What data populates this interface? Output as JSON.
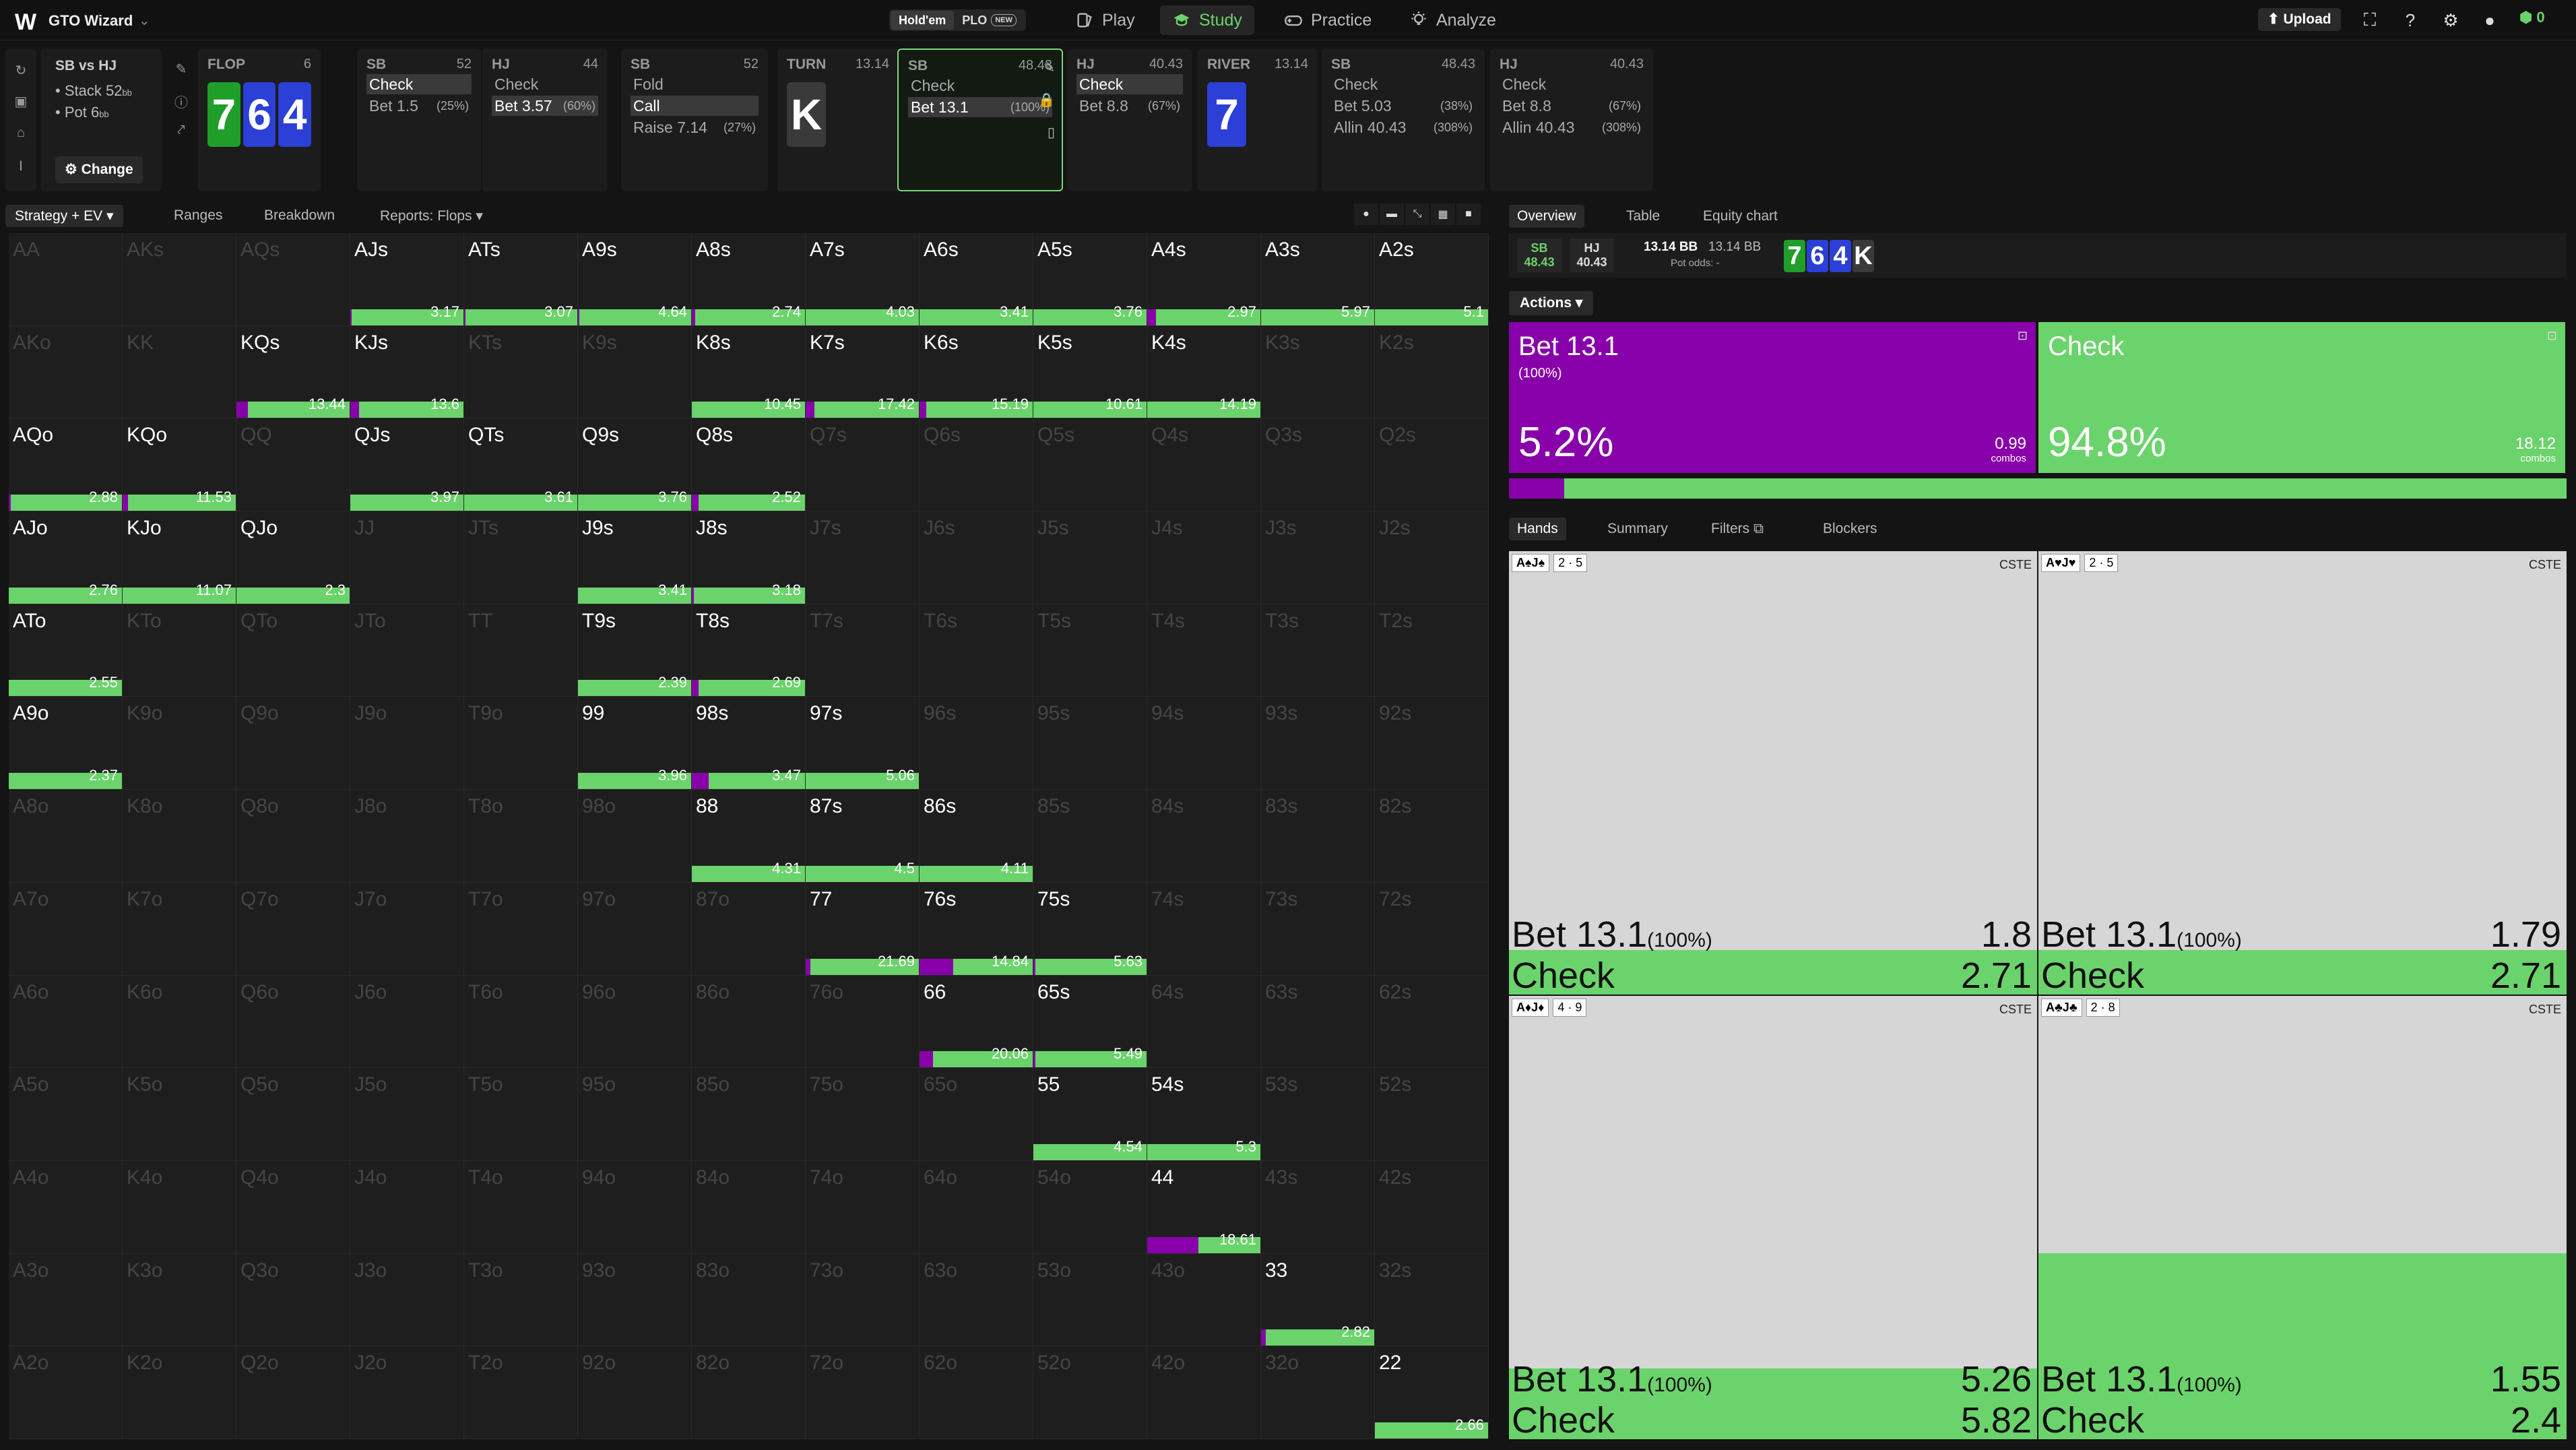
{
  "app": {
    "name": "GTO Wizard",
    "logo": "W"
  },
  "game_toggle": {
    "holdem": "Hold'em",
    "plo": "PLO",
    "new_badge": "NEW"
  },
  "nav": {
    "play": "Play",
    "study": "Study",
    "practice": "Practice",
    "analyze": "Analyze"
  },
  "top_right": {
    "upload": "Upload",
    "wallet": "0"
  },
  "spot": {
    "title": "SB vs HJ",
    "stack": "Stack 52",
    "stack_unit": "bb",
    "pot": "Pot 6",
    "pot_unit": "bb",
    "change": "Change"
  },
  "tree": [
    {
      "title": "FLOP",
      "value": "6",
      "board": [
        "7",
        "6",
        "4"
      ],
      "colors": [
        "g",
        "b",
        "b"
      ]
    },
    {
      "title": "SB",
      "value": "52",
      "actions": [
        {
          "a": "Check",
          "p": "",
          "sel": true
        },
        {
          "a": "Bet 1.5",
          "p": "(25%)",
          "sel": false
        }
      ]
    },
    {
      "title": "HJ",
      "value": "44",
      "actions": [
        {
          "a": "Check",
          "p": "",
          "sel": false
        },
        {
          "a": "Bet 3.57",
          "p": "(60%)",
          "sel": true
        }
      ]
    },
    {
      "title": "SB",
      "value": "52",
      "actions": [
        {
          "a": "Fold",
          "p": "",
          "sel": false
        },
        {
          "a": "Call",
          "p": "",
          "sel": true
        },
        {
          "a": "Raise 7.14",
          "p": "(27%)",
          "sel": false
        }
      ]
    },
    {
      "title": "TURN",
      "value": "13.14",
      "board": [
        "K"
      ],
      "colors": [
        "k"
      ]
    },
    {
      "title": "SB",
      "value": "48.43",
      "actions": [
        {
          "a": "Check",
          "p": "",
          "sel": false
        },
        {
          "a": "Bet 13.1",
          "p": "(100%)",
          "sel": true
        }
      ],
      "current": true
    },
    {
      "title": "HJ",
      "value": "40.43",
      "actions": [
        {
          "a": "Check",
          "p": "",
          "sel": true
        },
        {
          "a": "Bet 8.8",
          "p": "(67%)",
          "sel": false
        }
      ]
    },
    {
      "title": "RIVER",
      "value": "13.14",
      "board": [
        "7"
      ],
      "colors": [
        "b"
      ]
    },
    {
      "title": "SB",
      "value": "48.43",
      "actions": [
        {
          "a": "Check",
          "p": "",
          "sel": false
        },
        {
          "a": "Bet 5.03",
          "p": "(38%)",
          "sel": false
        },
        {
          "a": "Allin 40.43",
          "p": "(308%)",
          "sel": false
        }
      ]
    },
    {
      "title": "HJ",
      "value": "40.43",
      "actions": [
        {
          "a": "Check",
          "p": "",
          "sel": false
        },
        {
          "a": "Bet 8.8",
          "p": "(67%)",
          "sel": false
        },
        {
          "a": "Allin 40.43",
          "p": "(308%)",
          "sel": false
        }
      ]
    }
  ],
  "left_tabs": {
    "strategy": "Strategy + EV",
    "ranges": "Ranges",
    "breakdown": "Breakdown",
    "reports": "Reports: Flops"
  },
  "ranks": [
    "A",
    "K",
    "Q",
    "J",
    "T",
    "9",
    "8",
    "7",
    "6",
    "5",
    "4",
    "3",
    "2"
  ],
  "hands": {
    "AJs": {
      "ev": "3.17",
      "bet": 0.01
    },
    "ATs": {
      "ev": "3.07",
      "bet": 0.01
    },
    "A9s": {
      "ev": "4.64",
      "bet": 0.01
    },
    "A8s": {
      "ev": "2.74",
      "bet": 0.03
    },
    "A7s": {
      "ev": "4.03",
      "bet": 0
    },
    "A6s": {
      "ev": "3.41",
      "bet": 0
    },
    "A5s": {
      "ev": "3.76",
      "bet": 0
    },
    "A4s": {
      "ev": "2.97",
      "bet": 0.08
    },
    "A3s": {
      "ev": "5.97",
      "bet": 0
    },
    "A2s": {
      "ev": "5.1",
      "bet": 0
    },
    "KQs": {
      "ev": "13.44",
      "bet": 0.1
    },
    "KJs": {
      "ev": "13.6",
      "bet": 0.08
    },
    "K8s": {
      "ev": "10.45",
      "bet": 0
    },
    "K7s": {
      "ev": "17.42",
      "bet": 0.08
    },
    "K6s": {
      "ev": "15.19",
      "bet": 0.06
    },
    "K5s": {
      "ev": "10.61",
      "bet": 0
    },
    "K4s": {
      "ev": "14.19",
      "bet": 0
    },
    "AQo": {
      "ev": "2.88",
      "bet": 0.02
    },
    "KQo": {
      "ev": "11.53",
      "bet": 0.05
    },
    "QJs": {
      "ev": "3.97",
      "bet": 0
    },
    "QTs": {
      "ev": "3.61",
      "bet": 0
    },
    "Q9s": {
      "ev": "3.76",
      "bet": 0
    },
    "Q8s": {
      "ev": "2.52",
      "bet": 0.06
    },
    "AJo": {
      "ev": "2.76",
      "bet": 0
    },
    "KJo": {
      "ev": "11.07",
      "bet": 0
    },
    "QJo": {
      "ev": "2.3",
      "bet": 0
    },
    "J9s": {
      "ev": "3.41",
      "bet": 0
    },
    "J8s": {
      "ev": "3.18",
      "bet": 0.02
    },
    "ATo": {
      "ev": "2.55",
      "bet": 0
    },
    "T9s": {
      "ev": "2.39",
      "bet": 0
    },
    "T8s": {
      "ev": "2.69",
      "bet": 0.06
    },
    "A9o": {
      "ev": "2.37",
      "bet": 0
    },
    "99": {
      "ev": "3.96",
      "bet": 0
    },
    "98s": {
      "ev": "3.47",
      "bet": 0.15
    },
    "97s": {
      "ev": "5.06",
      "bet": 0
    },
    "88": {
      "ev": "4.31",
      "bet": 0
    },
    "87s": {
      "ev": "4.5",
      "bet": 0
    },
    "86s": {
      "ev": "4.11",
      "bet": 0
    },
    "77": {
      "ev": "21.69",
      "bet": 0.04
    },
    "76s": {
      "ev": "14.84",
      "bet": 0.3
    },
    "75s": {
      "ev": "5.63",
      "bet": 0.02
    },
    "66": {
      "ev": "20.06",
      "bet": 0.12
    },
    "65s": {
      "ev": "5.49",
      "bet": 0.02
    },
    "55": {
      "ev": "4.54",
      "bet": 0
    },
    "54s": {
      "ev": "5.3",
      "bet": 0
    },
    "44": {
      "ev": "18.61",
      "bet": 0.45
    },
    "33": {
      "ev": "2.82",
      "bet": 0.04
    },
    "22": {
      "ev": "2.66",
      "bet": 0
    }
  },
  "right_tabs": {
    "overview": "Overview",
    "table": "Table",
    "equity": "Equity chart"
  },
  "info": {
    "sb_label": "SB",
    "sb_val": "48.43",
    "hj_label": "HJ",
    "hj_val": "40.43",
    "pot_bb": "13.14 BB",
    "pot_bb2": "13.14 BB",
    "pot_odds": "Pot odds: -",
    "board": [
      "7",
      "6",
      "4",
      "K"
    ]
  },
  "actions_btn": "Actions",
  "action_blocks": [
    {
      "name": "Bet 13.1",
      "sub": "(100%)",
      "pct": "5.2%",
      "combos": "0.99",
      "combos_label": "combos",
      "color": "#8800aa"
    },
    {
      "name": "Check",
      "sub": "",
      "pct": "94.8%",
      "combos": "18.12",
      "combos_label": "combos",
      "color": "#6bd36b"
    }
  ],
  "strategy_split": {
    "bet": 0.052,
    "check": 0.948
  },
  "hand_tabs": {
    "hands": "Hands",
    "summary": "Summary",
    "filters": "Filters",
    "blockers": "Blockers"
  },
  "hand_cells": [
    {
      "cards": "A♠J♠",
      "b1": "2",
      "b2": "5",
      "tag": "CSTE",
      "bet_ev": "1.8",
      "check_ev": "2.71",
      "check_freq": 0.1,
      "bet_label": "Bet 13.1",
      "bet_pct": "(100%)",
      "check_label": "Check"
    },
    {
      "cards": "A♥J♥",
      "b1": "2",
      "b2": "5",
      "tag": "CSTE",
      "bet_ev": "1.79",
      "check_ev": "2.71",
      "check_freq": 0.1,
      "bet_label": "Bet 13.1",
      "bet_pct": "(100%)",
      "check_label": "Check"
    },
    {
      "cards": "A♦J♦",
      "b1": "4",
      "b2": "9",
      "tag": "CSTE",
      "bet_ev": "5.26",
      "check_ev": "5.82",
      "check_freq": 0.16,
      "bet_label": "Bet 13.1",
      "bet_pct": "(100%)",
      "check_label": "Check"
    },
    {
      "cards": "A♣J♣",
      "b1": "2",
      "b2": "8",
      "tag": "CSTE",
      "bet_ev": "1.55",
      "check_ev": "2.4",
      "check_freq": 0.42,
      "bet_label": "Bet 13.1",
      "bet_pct": "(100%)",
      "check_label": "Check"
    }
  ]
}
